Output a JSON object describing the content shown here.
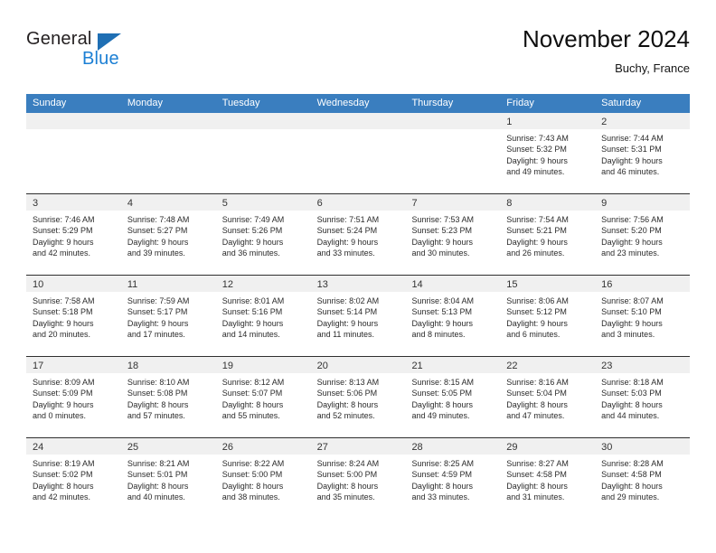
{
  "brand": {
    "name_part1": "General",
    "name_part2": "Blue",
    "triangle_color": "#1f6fb4",
    "blue_color": "#1b7fd4"
  },
  "header": {
    "title": "November 2024",
    "subtitle": "Buchy, France"
  },
  "theme": {
    "header_row_bg": "#3a7ebf",
    "day_band_bg": "#f0f0f0",
    "row_border": "#2f2f2f"
  },
  "weekdays": [
    "Sunday",
    "Monday",
    "Tuesday",
    "Wednesday",
    "Thursday",
    "Friday",
    "Saturday"
  ],
  "weeks": [
    [
      {
        "day": "",
        "empty": true
      },
      {
        "day": "",
        "empty": true
      },
      {
        "day": "",
        "empty": true
      },
      {
        "day": "",
        "empty": true
      },
      {
        "day": "",
        "empty": true
      },
      {
        "day": "1",
        "sunrise": "Sunrise: 7:43 AM",
        "sunset": "Sunset: 5:32 PM",
        "daylight1": "Daylight: 9 hours",
        "daylight2": "and 49 minutes."
      },
      {
        "day": "2",
        "sunrise": "Sunrise: 7:44 AM",
        "sunset": "Sunset: 5:31 PM",
        "daylight1": "Daylight: 9 hours",
        "daylight2": "and 46 minutes."
      }
    ],
    [
      {
        "day": "3",
        "sunrise": "Sunrise: 7:46 AM",
        "sunset": "Sunset: 5:29 PM",
        "daylight1": "Daylight: 9 hours",
        "daylight2": "and 42 minutes."
      },
      {
        "day": "4",
        "sunrise": "Sunrise: 7:48 AM",
        "sunset": "Sunset: 5:27 PM",
        "daylight1": "Daylight: 9 hours",
        "daylight2": "and 39 minutes."
      },
      {
        "day": "5",
        "sunrise": "Sunrise: 7:49 AM",
        "sunset": "Sunset: 5:26 PM",
        "daylight1": "Daylight: 9 hours",
        "daylight2": "and 36 minutes."
      },
      {
        "day": "6",
        "sunrise": "Sunrise: 7:51 AM",
        "sunset": "Sunset: 5:24 PM",
        "daylight1": "Daylight: 9 hours",
        "daylight2": "and 33 minutes."
      },
      {
        "day": "7",
        "sunrise": "Sunrise: 7:53 AM",
        "sunset": "Sunset: 5:23 PM",
        "daylight1": "Daylight: 9 hours",
        "daylight2": "and 30 minutes."
      },
      {
        "day": "8",
        "sunrise": "Sunrise: 7:54 AM",
        "sunset": "Sunset: 5:21 PM",
        "daylight1": "Daylight: 9 hours",
        "daylight2": "and 26 minutes."
      },
      {
        "day": "9",
        "sunrise": "Sunrise: 7:56 AM",
        "sunset": "Sunset: 5:20 PM",
        "daylight1": "Daylight: 9 hours",
        "daylight2": "and 23 minutes."
      }
    ],
    [
      {
        "day": "10",
        "sunrise": "Sunrise: 7:58 AM",
        "sunset": "Sunset: 5:18 PM",
        "daylight1": "Daylight: 9 hours",
        "daylight2": "and 20 minutes."
      },
      {
        "day": "11",
        "sunrise": "Sunrise: 7:59 AM",
        "sunset": "Sunset: 5:17 PM",
        "daylight1": "Daylight: 9 hours",
        "daylight2": "and 17 minutes."
      },
      {
        "day": "12",
        "sunrise": "Sunrise: 8:01 AM",
        "sunset": "Sunset: 5:16 PM",
        "daylight1": "Daylight: 9 hours",
        "daylight2": "and 14 minutes."
      },
      {
        "day": "13",
        "sunrise": "Sunrise: 8:02 AM",
        "sunset": "Sunset: 5:14 PM",
        "daylight1": "Daylight: 9 hours",
        "daylight2": "and 11 minutes."
      },
      {
        "day": "14",
        "sunrise": "Sunrise: 8:04 AM",
        "sunset": "Sunset: 5:13 PM",
        "daylight1": "Daylight: 9 hours",
        "daylight2": "and 8 minutes."
      },
      {
        "day": "15",
        "sunrise": "Sunrise: 8:06 AM",
        "sunset": "Sunset: 5:12 PM",
        "daylight1": "Daylight: 9 hours",
        "daylight2": "and 6 minutes."
      },
      {
        "day": "16",
        "sunrise": "Sunrise: 8:07 AM",
        "sunset": "Sunset: 5:10 PM",
        "daylight1": "Daylight: 9 hours",
        "daylight2": "and 3 minutes."
      }
    ],
    [
      {
        "day": "17",
        "sunrise": "Sunrise: 8:09 AM",
        "sunset": "Sunset: 5:09 PM",
        "daylight1": "Daylight: 9 hours",
        "daylight2": "and 0 minutes."
      },
      {
        "day": "18",
        "sunrise": "Sunrise: 8:10 AM",
        "sunset": "Sunset: 5:08 PM",
        "daylight1": "Daylight: 8 hours",
        "daylight2": "and 57 minutes."
      },
      {
        "day": "19",
        "sunrise": "Sunrise: 8:12 AM",
        "sunset": "Sunset: 5:07 PM",
        "daylight1": "Daylight: 8 hours",
        "daylight2": "and 55 minutes."
      },
      {
        "day": "20",
        "sunrise": "Sunrise: 8:13 AM",
        "sunset": "Sunset: 5:06 PM",
        "daylight1": "Daylight: 8 hours",
        "daylight2": "and 52 minutes."
      },
      {
        "day": "21",
        "sunrise": "Sunrise: 8:15 AM",
        "sunset": "Sunset: 5:05 PM",
        "daylight1": "Daylight: 8 hours",
        "daylight2": "and 49 minutes."
      },
      {
        "day": "22",
        "sunrise": "Sunrise: 8:16 AM",
        "sunset": "Sunset: 5:04 PM",
        "daylight1": "Daylight: 8 hours",
        "daylight2": "and 47 minutes."
      },
      {
        "day": "23",
        "sunrise": "Sunrise: 8:18 AM",
        "sunset": "Sunset: 5:03 PM",
        "daylight1": "Daylight: 8 hours",
        "daylight2": "and 44 minutes."
      }
    ],
    [
      {
        "day": "24",
        "sunrise": "Sunrise: 8:19 AM",
        "sunset": "Sunset: 5:02 PM",
        "daylight1": "Daylight: 8 hours",
        "daylight2": "and 42 minutes."
      },
      {
        "day": "25",
        "sunrise": "Sunrise: 8:21 AM",
        "sunset": "Sunset: 5:01 PM",
        "daylight1": "Daylight: 8 hours",
        "daylight2": "and 40 minutes."
      },
      {
        "day": "26",
        "sunrise": "Sunrise: 8:22 AM",
        "sunset": "Sunset: 5:00 PM",
        "daylight1": "Daylight: 8 hours",
        "daylight2": "and 38 minutes."
      },
      {
        "day": "27",
        "sunrise": "Sunrise: 8:24 AM",
        "sunset": "Sunset: 5:00 PM",
        "daylight1": "Daylight: 8 hours",
        "daylight2": "and 35 minutes."
      },
      {
        "day": "28",
        "sunrise": "Sunrise: 8:25 AM",
        "sunset": "Sunset: 4:59 PM",
        "daylight1": "Daylight: 8 hours",
        "daylight2": "and 33 minutes."
      },
      {
        "day": "29",
        "sunrise": "Sunrise: 8:27 AM",
        "sunset": "Sunset: 4:58 PM",
        "daylight1": "Daylight: 8 hours",
        "daylight2": "and 31 minutes."
      },
      {
        "day": "30",
        "sunrise": "Sunrise: 8:28 AM",
        "sunset": "Sunset: 4:58 PM",
        "daylight1": "Daylight: 8 hours",
        "daylight2": "and 29 minutes."
      }
    ]
  ]
}
